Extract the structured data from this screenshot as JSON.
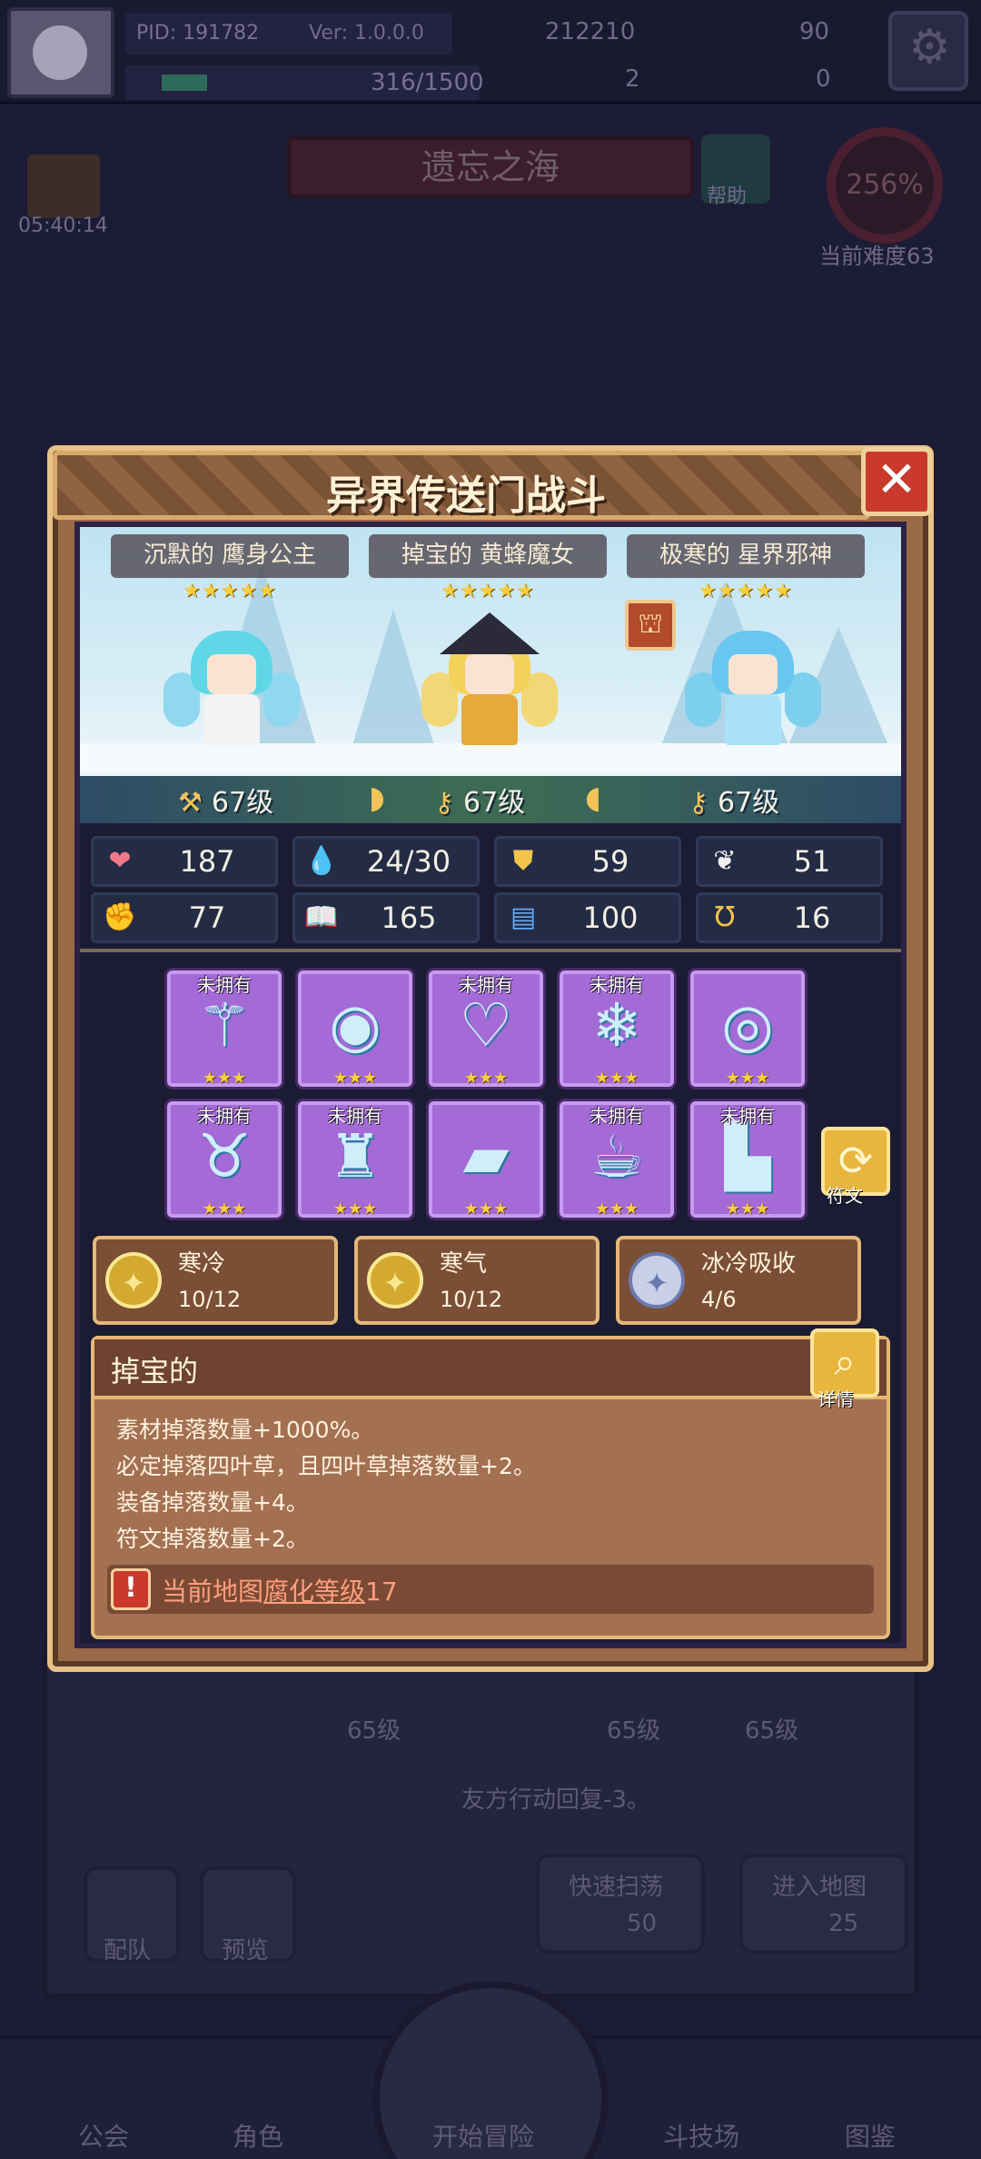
{
  "topbar": {
    "pid": "PID: 191782",
    "version": "Ver: 1.0.0.0",
    "exp": "316/1500",
    "currency1": "212210",
    "currency2": "90",
    "currency3": "2",
    "currency4": "0"
  },
  "map": {
    "name": "遗忘之海",
    "help": "帮助",
    "difficulty_pct": "256%",
    "difficulty_label": "当前难度63",
    "timer": "05:40:14"
  },
  "background": {
    "levels": [
      "65级",
      "65级",
      "65级"
    ],
    "skill_text": "友方行动回复-3。",
    "team_btn": "配队",
    "preview_btn": "预览",
    "quick_sweep": "快速扫荡",
    "quick_sweep_cost": "50",
    "enter_map": "进入地图",
    "enter_map_cost": "25",
    "nav": [
      "公会",
      "角色",
      "开始冒险",
      "斗技场",
      "图鉴"
    ]
  },
  "modal": {
    "title": "异界传送门战斗",
    "heroes": [
      {
        "name": "沉默的 鹰身公主",
        "stars": "★★★★★",
        "level": "67级",
        "colors": {
          "hair": "#5fd7e6",
          "body": "#f3f3f3",
          "wing": "#8fd8f0"
        }
      },
      {
        "name": "掉宝的 黄蜂魔女",
        "stars": "★★★★★",
        "level": "67级",
        "colors": {
          "hair": "#f4d25a",
          "body": "#e6a93c",
          "wing": "#f2d776"
        }
      },
      {
        "name": "极寒的 星界邪神",
        "stars": "★★★★★",
        "level": "67级",
        "colors": {
          "hair": "#67c7ee",
          "body": "#a9e2f7",
          "wing": "#7dcfee"
        }
      }
    ],
    "stats": [
      {
        "icon": "heart-icon",
        "glyph": "❤",
        "color": "#f07a8a",
        "value": "187"
      },
      {
        "icon": "drop-icon",
        "glyph": "💧",
        "color": "#6fc8f0",
        "value": "24/30"
      },
      {
        "icon": "shield-icon",
        "glyph": "⛊",
        "color": "#f2c44a",
        "value": "59"
      },
      {
        "icon": "wing-icon",
        "glyph": "❦",
        "color": "#f0f0f0",
        "value": "51"
      },
      {
        "icon": "fist-icon",
        "glyph": "✊",
        "color": "#e8a88a",
        "value": "77"
      },
      {
        "icon": "book-icon",
        "glyph": "📖",
        "color": "#e86a5a",
        "value": "165"
      },
      {
        "icon": "scroll-icon",
        "glyph": "▤",
        "color": "#6aa8f0",
        "value": "100"
      },
      {
        "icon": "horseshoe-icon",
        "glyph": "Ʊ",
        "color": "#f2c44a",
        "value": "16"
      }
    ],
    "equipment": [
      {
        "name": "staff",
        "glyph": "⚚",
        "owned_label": "未拥有",
        "stars": "★★★"
      },
      {
        "name": "orb",
        "glyph": "◉",
        "owned_label": "",
        "stars": "★★★"
      },
      {
        "name": "necklace",
        "glyph": "♡",
        "owned_label": "未拥有",
        "stars": "★★★"
      },
      {
        "name": "snowflake",
        "glyph": "❄",
        "owned_label": "未拥有",
        "stars": "★★★"
      },
      {
        "name": "ring",
        "glyph": "◎",
        "owned_label": "",
        "stars": "★★★"
      },
      {
        "name": "helmet",
        "glyph": "♉",
        "owned_label": "未拥有",
        "stars": "★★★"
      },
      {
        "name": "armor",
        "glyph": "♜",
        "owned_label": "未拥有",
        "stars": "★★★"
      },
      {
        "name": "bracer",
        "glyph": "▰",
        "owned_label": "",
        "stars": "★★★"
      },
      {
        "name": "gloves",
        "glyph": "☕",
        "owned_label": "未拥有",
        "stars": "★★★"
      },
      {
        "name": "boots",
        "glyph": "▙",
        "owned_label": "未拥有",
        "stars": "★★★"
      }
    ],
    "rune_label": "符文",
    "buffs": [
      {
        "name": "寒冷",
        "count": "10/12",
        "icon": "gold-coin-icon",
        "bg": "#d4a930",
        "fg": "#f8e890"
      },
      {
        "name": "寒气",
        "count": "10/12",
        "icon": "gold-coin-icon",
        "bg": "#d4a930",
        "fg": "#f8e890"
      },
      {
        "name": "冰冷吸收",
        "count": "4/6",
        "icon": "silver-coin-icon",
        "bg": "#c8d0e8",
        "fg": "#6a7ab0"
      }
    ],
    "trait": {
      "name": "掉宝的",
      "detail_label": "详情",
      "lines": [
        "素材掉落数量+1000%。",
        "必定掉落四叶草，且四叶草掉落数量+2。",
        "装备掉落数量+4。",
        "符文掉落数量+2。"
      ],
      "warning_prefix": "当前地图",
      "warning_link": "腐化等级",
      "warning_value": "17"
    }
  }
}
